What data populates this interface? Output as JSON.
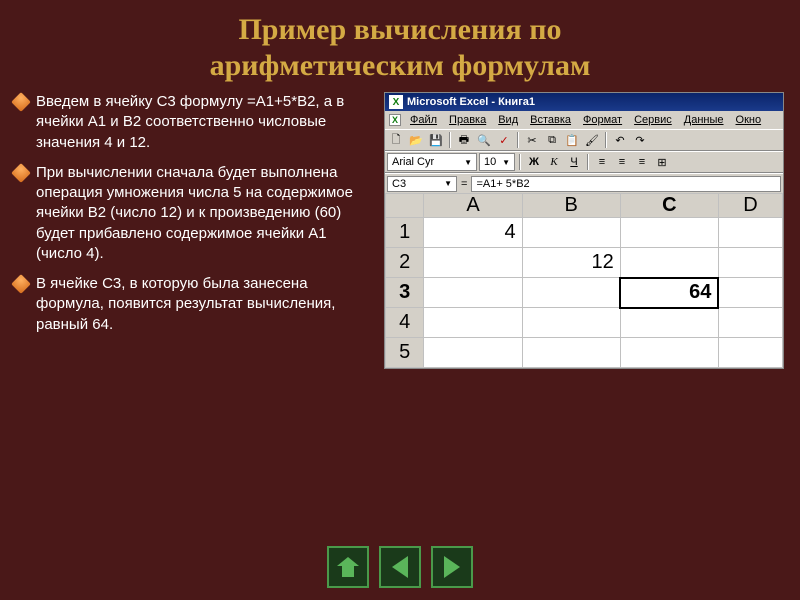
{
  "title_line1": "Пример вычисления по",
  "title_line2": "арифметическим формулам",
  "bullets": [
    "Введем в ячейку С3 формулу =А1+5*В2, а в ячейки А1 и В2 соответственно числовые значения 4 и 12.",
    "При вычислении сначала будет выполнена операция умножения числа 5 на содержимое ячейки В2 (число 12) и к произведению (60) будет прибавлено содержимое ячейки А1 (число 4).",
    "В ячейке С3, в которую была занесена формула, появится результат вычисления, равный 64."
  ],
  "excel": {
    "app_title": "Microsoft Excel - Книга1",
    "menu": [
      "Файл",
      "Правка",
      "Вид",
      "Вставка",
      "Формат",
      "Сервис",
      "Данные",
      "Окно"
    ],
    "font_name": "Arial Cyr",
    "font_size": "10",
    "name_box": "C3",
    "formula": "=A1+ 5*B2",
    "columns": [
      "A",
      "B",
      "C",
      "D"
    ],
    "rows": [
      "1",
      "2",
      "3",
      "4",
      "5"
    ],
    "cells": {
      "A1": "4",
      "B2": "12",
      "C3": "64"
    },
    "active": "C3"
  }
}
